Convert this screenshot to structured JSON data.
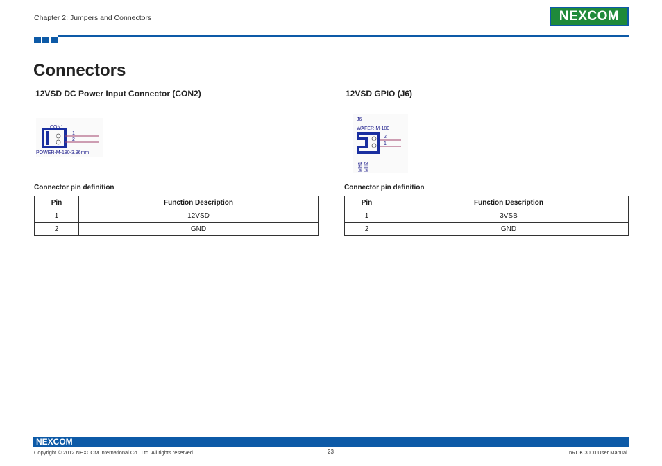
{
  "header": {
    "chapter": "Chapter 2: Jumpers and Connectors",
    "logo_text": "NEXCOM"
  },
  "page_title": "Connectors",
  "left_section": {
    "heading": "12VSD DC Power Input Connector (CON2)",
    "schematic": {
      "ref": "CON1",
      "pin1": "1",
      "pin2": "2",
      "part": "POWER-M-180-3.96mm"
    },
    "caption": "Connector pin definition",
    "table": {
      "headers": [
        "Pin",
        "Function Description"
      ],
      "rows": [
        [
          "1",
          "12VSD"
        ],
        [
          "2",
          "GND"
        ]
      ]
    }
  },
  "right_section": {
    "heading": "12VSD GPIO (J6)",
    "schematic": {
      "ref": "J6",
      "part": "WAFER-M-180",
      "pin2": "2",
      "pin1": "1",
      "mh1": "MH1",
      "mh2": "MH2"
    },
    "caption": "Connector pin definition",
    "table": {
      "headers": [
        "Pin",
        "Function Description"
      ],
      "rows": [
        [
          "1",
          "3VSB"
        ],
        [
          "2",
          "GND"
        ]
      ]
    }
  },
  "footer": {
    "logo_text": "NEXCOM",
    "copyright": "Copyright © 2012 NEXCOM International Co., Ltd. All rights reserved",
    "page_number": "23",
    "manual": "nROK 3000 User Manual"
  },
  "colors": {
    "brand_blue": "#0d5aa7",
    "brand_green": "#1f8a3a"
  }
}
